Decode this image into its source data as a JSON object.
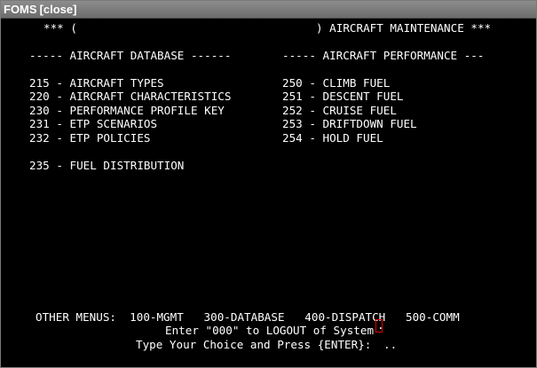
{
  "window": {
    "title": "FOMS",
    "close_label": "[close]"
  },
  "header": {
    "left": "*** (",
    "right": ") AIRCRAFT MAINTENANCE ***"
  },
  "sections": {
    "database_heading": "----- AIRCRAFT DATABASE ------",
    "performance_heading": "----- AIRCRAFT PERFORMANCE ---"
  },
  "database_items": [
    "215 - AIRCRAFT TYPES",
    "220 - AIRCRAFT CHARACTERISTICS",
    "230 - PERFORMANCE PROFILE KEY",
    "231 - ETP SCENARIOS",
    "232 - ETP POLICIES",
    "235 - FUEL DISTRIBUTION"
  ],
  "performance_items": [
    "250 - CLIMB FUEL",
    "251 - DESCENT FUEL",
    "252 - CRUISE FUEL",
    "253 - DRIFTDOWN FUEL",
    "254 - HOLD FUEL"
  ],
  "footer": {
    "other_menus": "OTHER MENUS:  100-MGMT   300-DATABASE   400-DISPATCH   500-COMM",
    "logout_hint": "Enter \"000\" to LOGOUT of System",
    "prompt": "Type Your Choice and Press {ENTER}:",
    "input_value": ".",
    "input_trailing": ".."
  },
  "colors": {
    "background": "#000000",
    "text": "#ffffff",
    "titlebar": "#7a7a7a",
    "cursor_border": "#e00000"
  }
}
